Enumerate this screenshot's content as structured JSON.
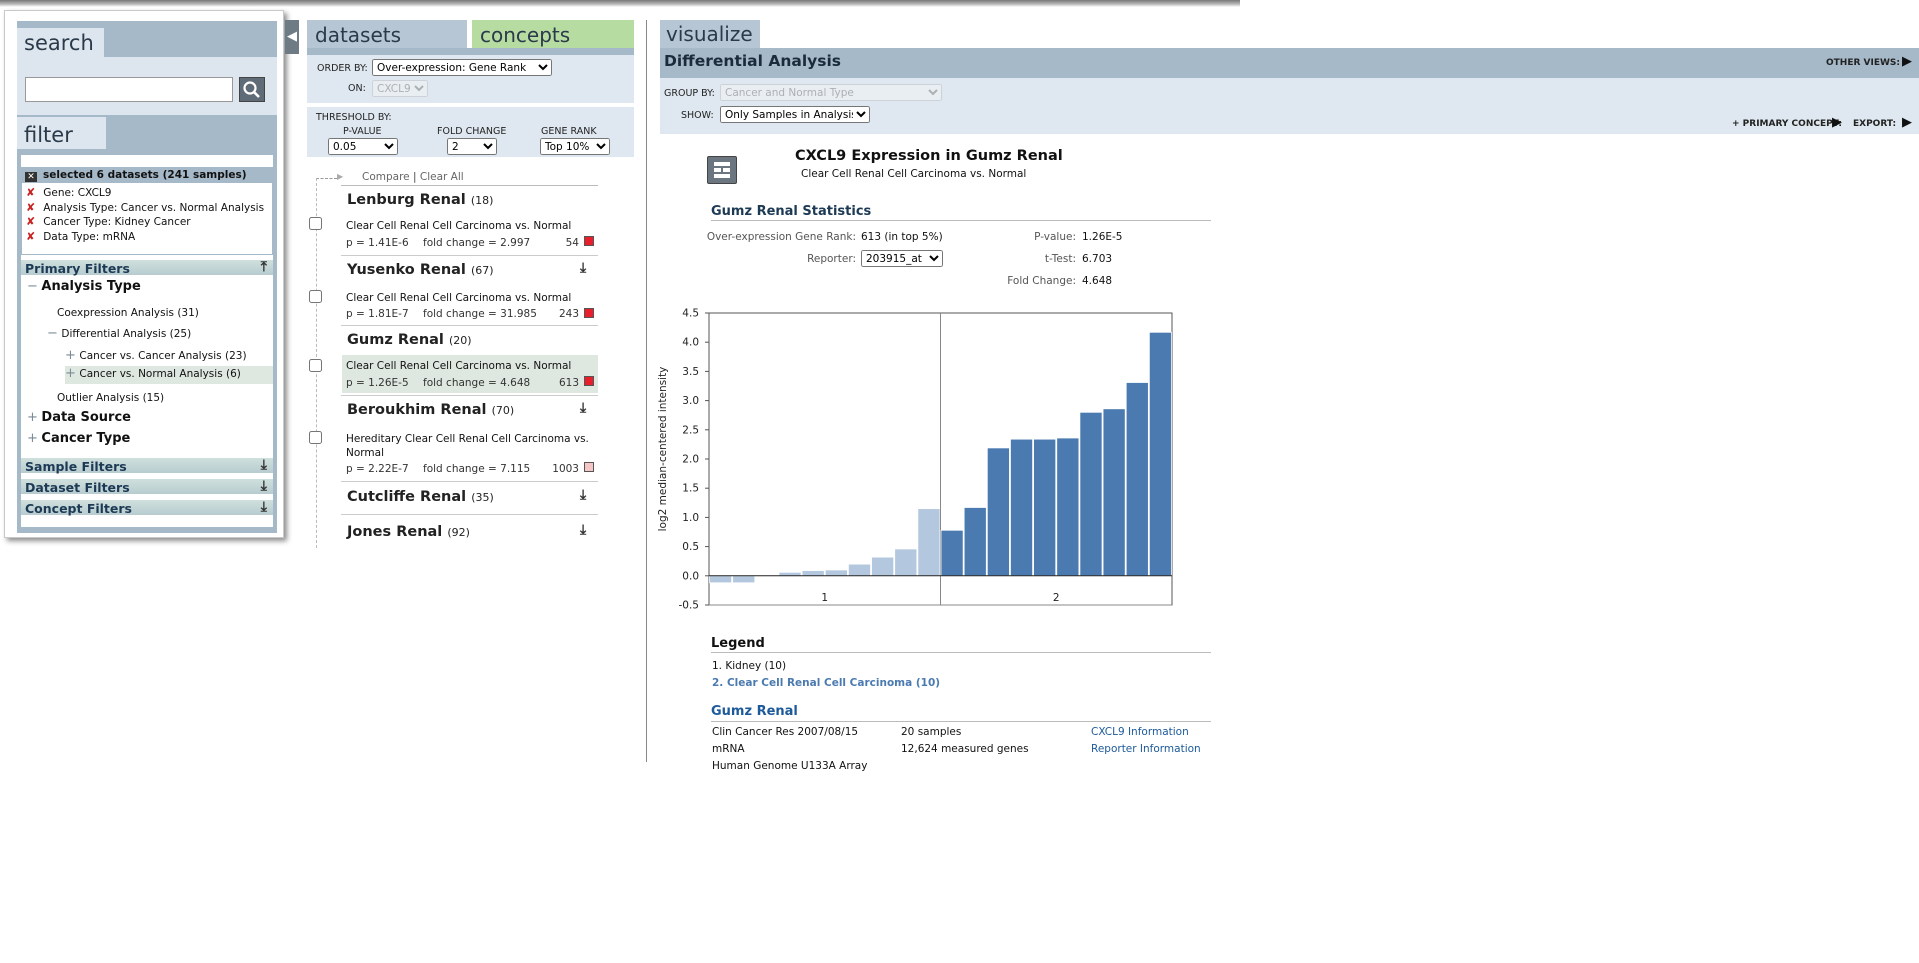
{
  "search": {
    "tab_label": "search",
    "input_value": ""
  },
  "filter": {
    "tab_label": "filter",
    "selected_label": "selected 6 datasets (241 samples)",
    "selected_items": [
      "Gene: CXCL9",
      "Analysis Type: Cancer vs. Normal Analysis",
      "Cancer Type: Kidney Cancer",
      "Data Type: mRNA"
    ],
    "primary_filters": "Primary Filters",
    "analysis_type": "Analysis Type",
    "coexpression": "Coexpression Analysis (31)",
    "differential": "Differential Analysis (25)",
    "cancer_vs_cancer": "Cancer vs. Cancer Analysis (23)",
    "cancer_vs_normal": "Cancer vs. Normal Analysis (6)",
    "outlier": "Outlier Analysis (15)",
    "data_source": "Data Source",
    "cancer_type": "Cancer Type",
    "sample_filters": "Sample Filters",
    "dataset_filters": "Dataset Filters",
    "concept_filters": "Concept Filters"
  },
  "datasets": {
    "tab_label": "datasets",
    "concepts_tab_label": "concepts",
    "order_by_label": "ORDER BY:",
    "order_by_value": "Over-expression: Gene Rank",
    "on_label": "ON:",
    "on_value": "CXCL9",
    "threshold_label": "THRESHOLD BY:",
    "pvalue_label": "P-VALUE",
    "pvalue_value": "0.05",
    "fold_label": "FOLD CHANGE",
    "fold_value": "2",
    "rank_label": "GENE RANK",
    "rank_value": "Top 10%",
    "compare_label": "Compare",
    "clear_all_label": "Clear All",
    "items": [
      {
        "name": "Lenburg Renal",
        "count": "(18)",
        "analysis": "Clear Cell Renal Cell Carcinoma vs. Normal",
        "p": "p = 1.41E-6",
        "fold": "fold change = 2.997",
        "rank": "54"
      },
      {
        "name": "Yusenko Renal",
        "count": "(67)",
        "analysis": "Clear Cell Renal Cell Carcinoma vs. Normal",
        "p": "p = 1.81E-7",
        "fold": "fold change = 31.985",
        "rank": "243"
      },
      {
        "name": "Gumz Renal",
        "count": "(20)",
        "analysis": "Clear Cell Renal Cell Carcinoma vs. Normal",
        "p": "p = 1.26E-5",
        "fold": "fold change = 4.648",
        "rank": "613"
      },
      {
        "name": "Beroukhim Renal",
        "count": "(70)",
        "analysis": "Hereditary Clear Cell Renal Cell Carcinoma vs. Normal",
        "p": "p = 2.22E-7",
        "fold": "fold change = 7.115",
        "rank": "1003"
      },
      {
        "name": "Cutcliffe Renal",
        "count": "(35)"
      },
      {
        "name": "Jones Renal",
        "count": "(92)"
      }
    ]
  },
  "visualize": {
    "tab_label": "visualize",
    "title": "Differential Analysis",
    "other_views": "OTHER VIEWS:",
    "group_by_label": "GROUP BY:",
    "group_by_value": "Cancer and Normal Type",
    "show_label": "SHOW:",
    "show_value": "Only Samples in Analysis",
    "primary_concept": "+ PRIMARY CONCEPT:",
    "export": "EXPORT:",
    "chart_title": "CXCL9 Expression in Gumz Renal",
    "chart_subtitle": "Clear Cell Renal Cell Carcinoma vs. Normal",
    "stats_head": "Gumz Renal Statistics",
    "stats": {
      "rank_label": "Over-expression Gene Rank:",
      "rank_value": "613 (in top 5%)",
      "reporter_label": "Reporter:",
      "reporter_value": "203915_at",
      "pvalue_label": "P-value:",
      "pvalue_value": "1.26E-5",
      "ttest_label": "t-Test:",
      "ttest_value": "6.703",
      "fold_label": "Fold Change:",
      "fold_value": "4.648"
    },
    "legend_head": "Legend",
    "legend_1": "1. Kidney (10)",
    "legend_2": "2. Clear Cell Renal Cell Carcinoma (10)",
    "dataset_head": "Gumz Renal",
    "info": {
      "ref": "Clin Cancer Res 2007/08/15",
      "type": "mRNA",
      "platform": "Human Genome U133A Array",
      "samples": "20 samples",
      "genes": "12,624 measured genes",
      "gene_info": "CXCL9 Information",
      "reporter_info": "Reporter Information"
    }
  },
  "chart_data": {
    "type": "bar",
    "ylabel": "log2 median-centered intensity",
    "ylim": [
      -0.5,
      4.5
    ],
    "yticks": [
      "-0.5",
      "0.0",
      "0.5",
      "1.0",
      "1.5",
      "2.0",
      "2.5",
      "3.0",
      "3.5",
      "4.0",
      "4.5"
    ],
    "groups": [
      "1",
      "2"
    ],
    "series": [
      {
        "values": [
          -0.12,
          -0.12,
          0.0,
          0.06,
          0.09,
          0.1,
          0.2,
          0.32,
          0.46,
          1.15
        ],
        "color": "#b3c8de"
      },
      {
        "values": [
          0.78,
          1.17,
          2.19,
          2.34,
          2.34,
          2.36,
          2.8,
          2.86,
          3.31,
          4.17
        ],
        "color": "#4a7aaf"
      }
    ]
  }
}
